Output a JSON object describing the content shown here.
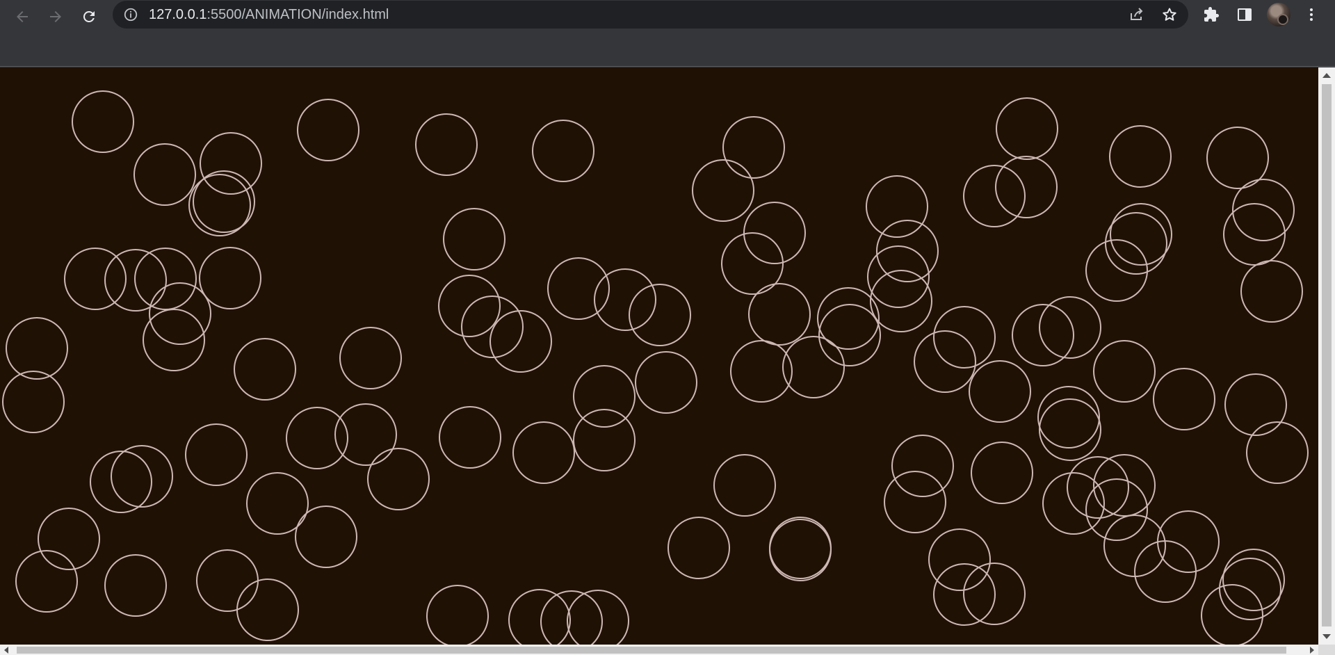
{
  "browser": {
    "url_host": "127.0.0.1",
    "url_rest": ":5500/ANIMATION/index.html",
    "icons": {
      "back": "arrow-left-icon",
      "forward": "arrow-right-icon",
      "reload": "reload-icon",
      "info": "info-icon",
      "share": "share-icon",
      "bookmark": "star-icon",
      "extensions": "puzzle-icon",
      "side_panel": "side-panel-icon",
      "menu": "kebab-menu-icon"
    }
  },
  "page": {
    "background": "#201105",
    "circle_stroke": "#cdb8b4",
    "circle_count": 118
  }
}
